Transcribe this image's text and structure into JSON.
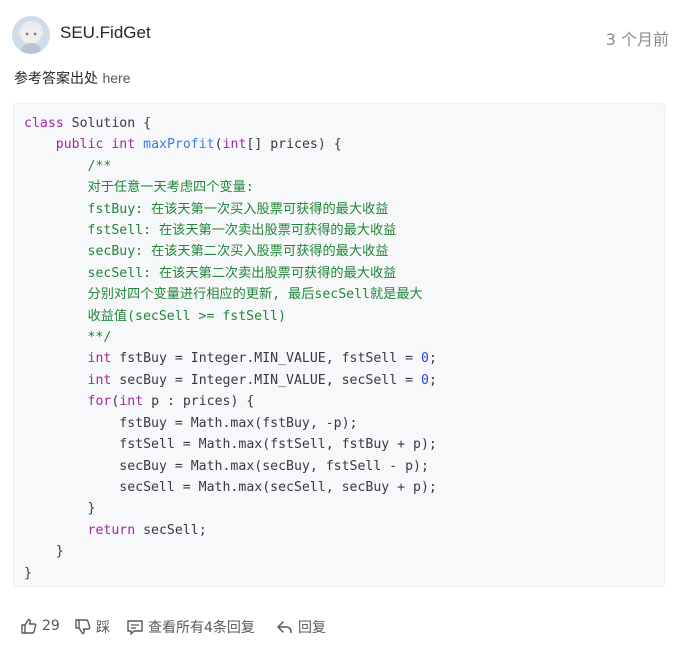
{
  "post": {
    "username": "SEU.FidGet",
    "time": "3 个月前",
    "intro_text": "参考答案出处 ",
    "intro_link": "here"
  },
  "code": {
    "l1_kw": "class",
    "l1_rest": " Solution {",
    "l2_kw1": "public",
    "l2_kw2": "int",
    "l2_fn": "maxProfit",
    "l2_p1": "(",
    "l2_kw3": "int",
    "l2_p2": "[] prices) {",
    "c1": "/**",
    "c2": "对于任意一天考虑四个变量:",
    "c3": "fstBuy: 在该天第一次买入股票可获得的最大收益",
    "c4": "fstSell: 在该天第一次卖出股票可获得的最大收益",
    "c5": "secBuy: 在该天第二次买入股票可获得的最大收益",
    "c6": "secSell: 在该天第二次卖出股票可获得的最大收益",
    "c7": "分别对四个变量进行相应的更新, 最后secSell就是最大",
    "c8": "收益值(secSell >= fstSell)",
    "c9": "**/",
    "d1_kw": "int",
    "d1_rest": " fstBuy = Integer.MIN_VALUE, fstSell = ",
    "d1_num": "0",
    "d2_kw": "int",
    "d2_rest": " secBuy = Integer.MIN_VALUE, secSell = ",
    "d2_num": "0",
    "f_kw1": "for",
    "f_p1": "(",
    "f_kw2": "int",
    "f_rest": " p : prices) {",
    "b1": "fstBuy = Math.max(fstBuy, -p);",
    "b2": "fstSell = Math.max(fstSell, fstBuy + p);",
    "b3": "secBuy = Math.max(secBuy, fstSell - p);",
    "b4": "secSell = Math.max(secSell, secBuy + p);",
    "close_for": "}",
    "r_kw": "return",
    "r_rest": " secSell;",
    "close_method": "}",
    "close_class": "}"
  },
  "actions": {
    "like_count": "29",
    "dislike_label": "踩",
    "replies_label": "查看所有4条回复",
    "reply_label": "回复"
  },
  "colors": {
    "keyword": "#a626a4",
    "function": "#4078f2",
    "number": "#2a42d8",
    "comment": "#22863a"
  }
}
